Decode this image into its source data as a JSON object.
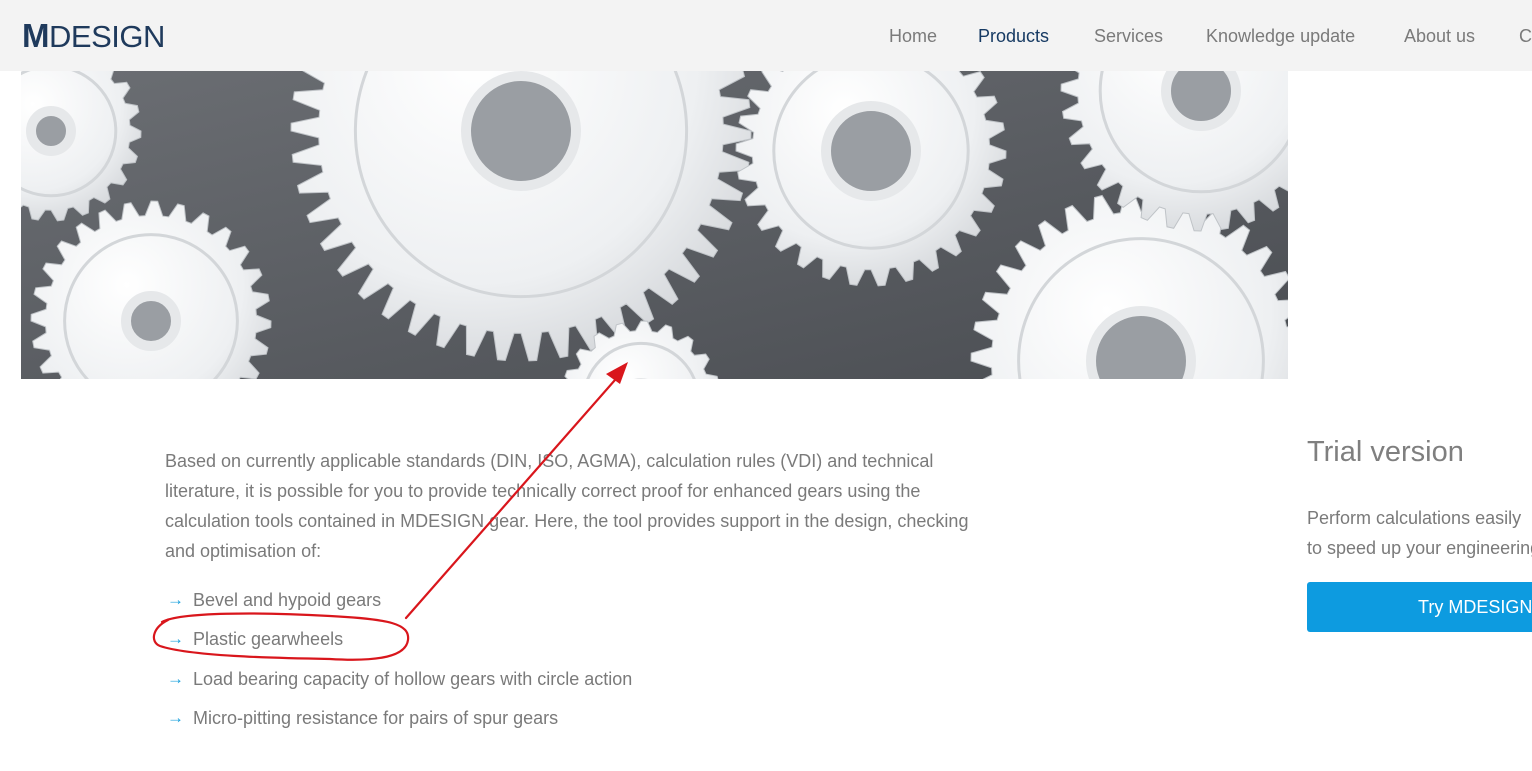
{
  "header": {
    "logo_m": "M",
    "logo_rest": "DESIGN",
    "nav": [
      "Home",
      "Products",
      "Services",
      "Knowledge update",
      "About us",
      "C"
    ],
    "active": "Products"
  },
  "hero": {
    "alt": "white plastic gearwheels"
  },
  "main": {
    "intro": "Based on currently applicable standards (DIN, ISO, AGMA), calculation rules (VDI) and technical literature, it is possible for you to provide technically correct proof for enhanced gears using the calculation tools contained in MDESIGN gear. Here, the tool provides support in the design, checking and optimisation of:",
    "bullet_icon": "→",
    "bullets": [
      "Bevel and hypoid gears",
      "Plastic gearwheels",
      "Load bearing capacity of hollow gears with circle action",
      "Micro-pitting resistance for pairs of spur gears"
    ]
  },
  "sidebar": {
    "title": "Trial version",
    "text_line1": "Perform calculations easily",
    "text_line2": "to speed up your engineering",
    "button": "Try MDESIGN"
  },
  "annotation": {
    "color": "#d9161c",
    "shape": "arrow-and-ellipse"
  }
}
